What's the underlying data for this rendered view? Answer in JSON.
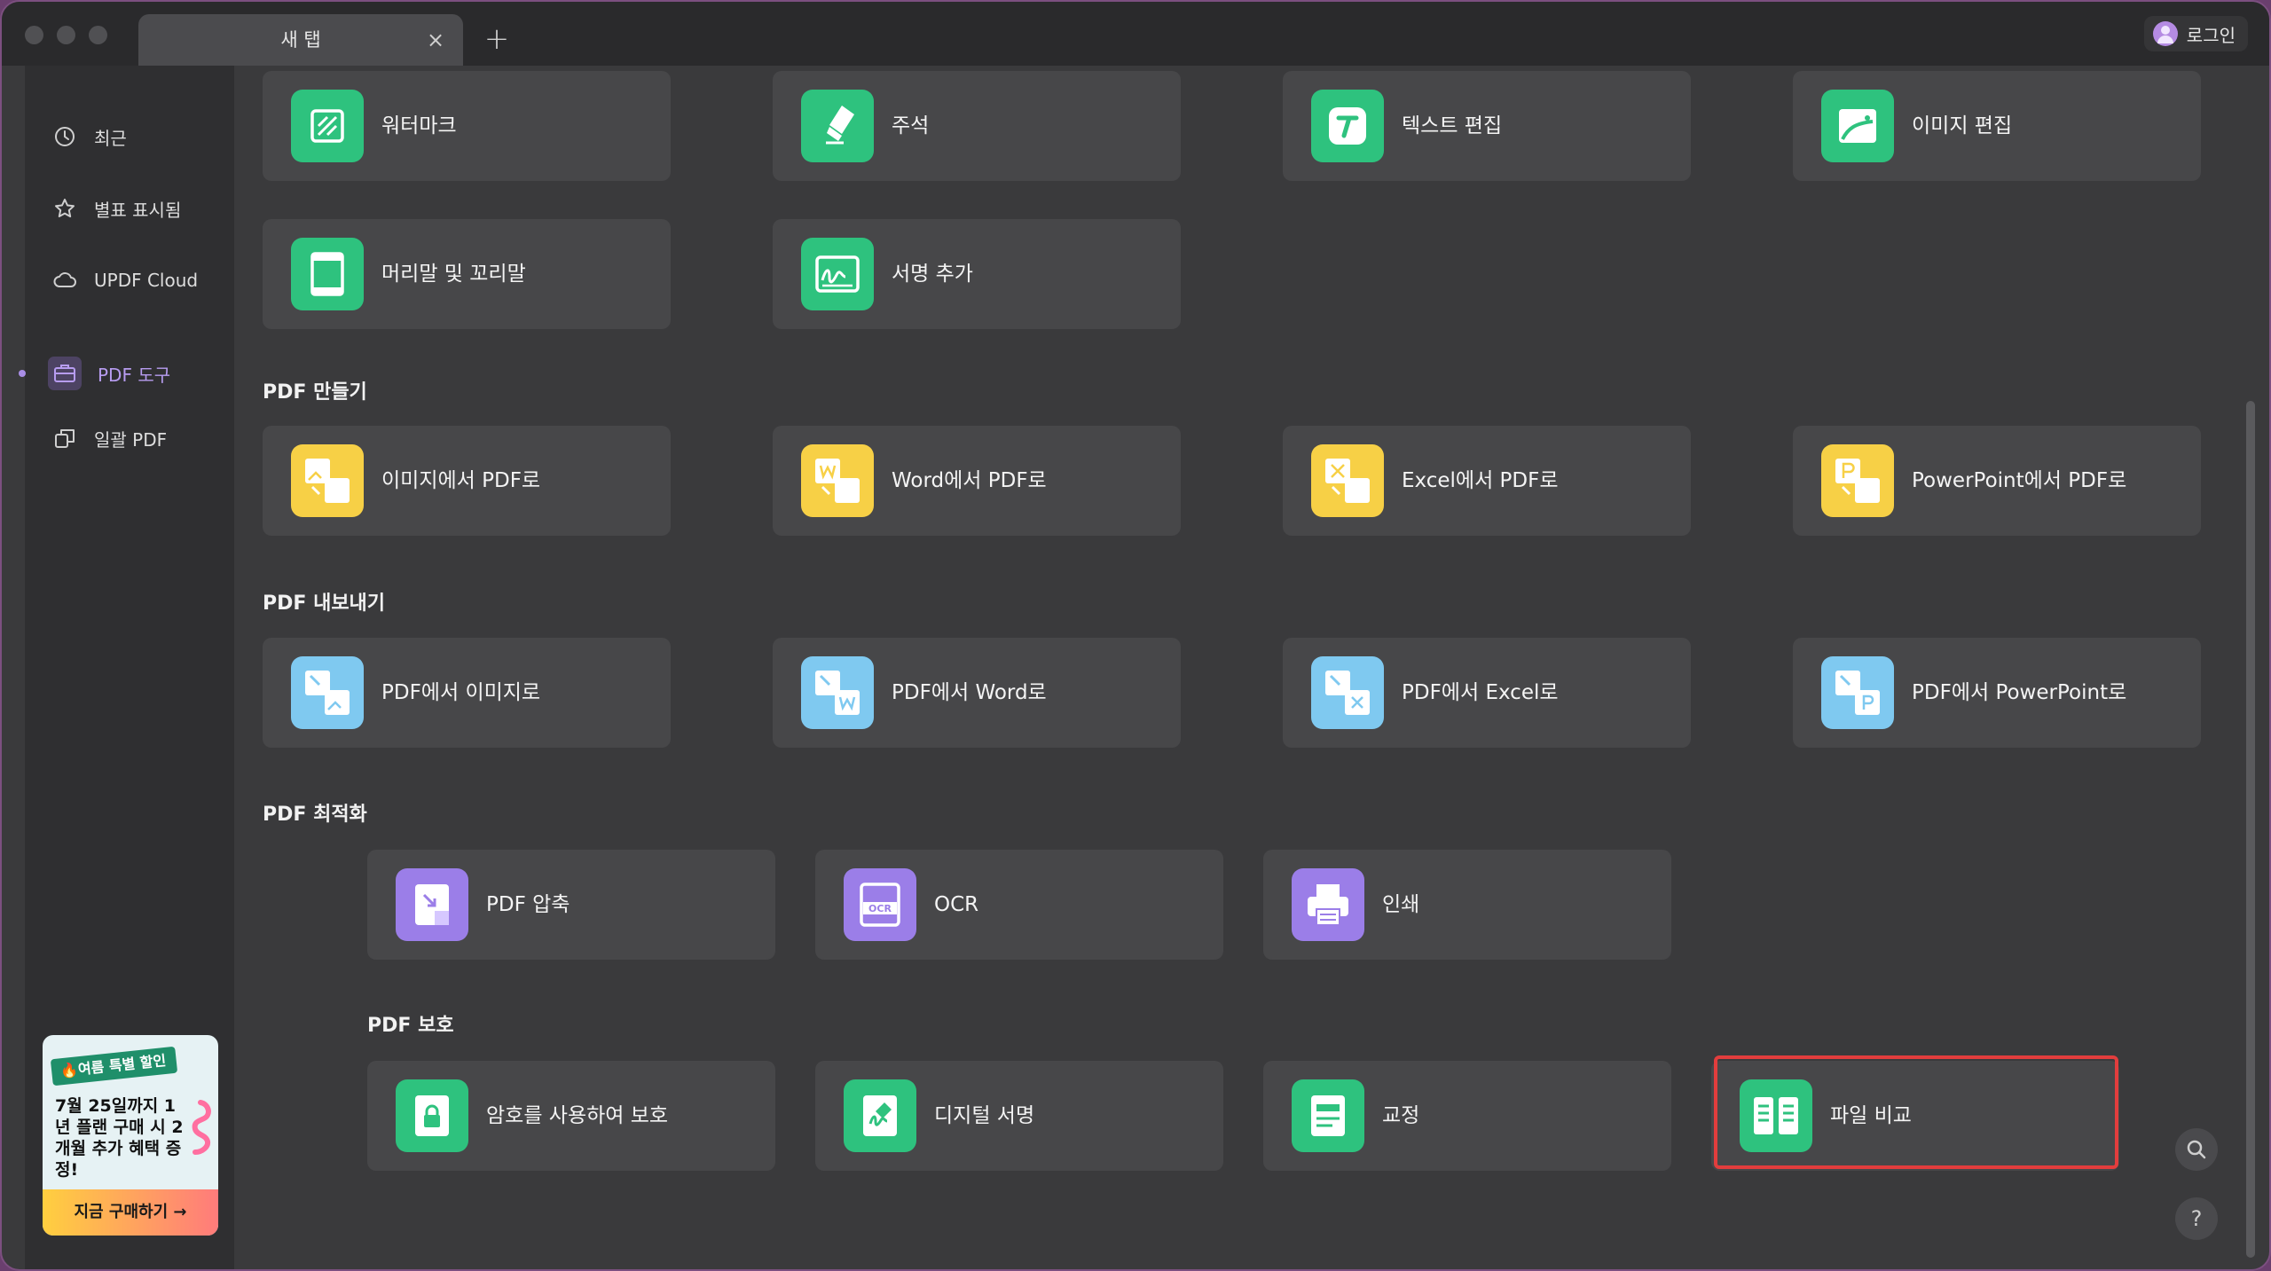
{
  "window": {
    "tab_title": "새 탭",
    "login_label": "로그인"
  },
  "sidebar": {
    "items": [
      {
        "label": "최근",
        "icon": "clock-icon"
      },
      {
        "label": "별표 표시됨",
        "icon": "star-icon"
      },
      {
        "label": "UPDF Cloud",
        "icon": "cloud-icon"
      },
      {
        "label": "PDF 도구",
        "icon": "briefcase-icon",
        "active": true
      },
      {
        "label": "일괄 PDF",
        "icon": "batch-icon"
      }
    ]
  },
  "promo": {
    "badge": "🔥여름 특별 할인",
    "text": "7월 25일까지 1년 플랜 구매 시 2개월 추가 혜택 증정!",
    "cta": "지금 구매하기 →"
  },
  "edit_tools": [
    {
      "label": "워터마크",
      "icon": "watermark-icon",
      "color": "#2ec27e"
    },
    {
      "label": "주석",
      "icon": "highlighter-icon",
      "color": "#2ec27e"
    },
    {
      "label": "텍스트 편집",
      "icon": "text-edit-icon",
      "color": "#2ec27e"
    },
    {
      "label": "이미지 편집",
      "icon": "image-edit-icon",
      "color": "#2ec27e"
    },
    {
      "label": "머리말 및 꼬리말",
      "icon": "header-footer-icon",
      "color": "#2ec27e"
    },
    {
      "label": "서명 추가",
      "icon": "signature-icon",
      "color": "#2ec27e"
    }
  ],
  "sections": {
    "create": {
      "title": "PDF 만들기",
      "items": [
        {
          "label": "이미지에서 PDF로",
          "icon": "image-to-pdf-icon",
          "color": "#f7d046"
        },
        {
          "label": "Word에서 PDF로",
          "icon": "word-to-pdf-icon",
          "color": "#f7d046"
        },
        {
          "label": "Excel에서 PDF로",
          "icon": "excel-to-pdf-icon",
          "color": "#f7d046"
        },
        {
          "label": "PowerPoint에서 PDF로",
          "icon": "powerpoint-to-pdf-icon",
          "color": "#f7d046"
        }
      ]
    },
    "export": {
      "title": "PDF 내보내기",
      "items": [
        {
          "label": "PDF에서 이미지로",
          "icon": "pdf-to-image-icon",
          "color": "#7fc9f0"
        },
        {
          "label": "PDF에서 Word로",
          "icon": "pdf-to-word-icon",
          "color": "#7fc9f0"
        },
        {
          "label": "PDF에서 Excel로",
          "icon": "pdf-to-excel-icon",
          "color": "#7fc9f0"
        },
        {
          "label": "PDF에서 PowerPoint로",
          "icon": "pdf-to-powerpoint-icon",
          "color": "#7fc9f0"
        }
      ]
    },
    "optimize": {
      "title": "PDF 최적화",
      "items": [
        {
          "label": "PDF 압축",
          "icon": "compress-icon",
          "color": "#9b7ee8"
        },
        {
          "label": "OCR",
          "icon": "ocr-icon",
          "color": "#9b7ee8"
        },
        {
          "label": "인쇄",
          "icon": "printer-icon",
          "color": "#9b7ee8"
        }
      ]
    },
    "protect": {
      "title": "PDF 보호",
      "items": [
        {
          "label": "암호를 사용하여 보호",
          "icon": "lock-icon",
          "color": "#2ec27e"
        },
        {
          "label": "디지털 서명",
          "icon": "digital-signature-icon",
          "color": "#2ec27e"
        },
        {
          "label": "교정",
          "icon": "redact-icon",
          "color": "#2ec27e"
        },
        {
          "label": "파일 비교",
          "icon": "compare-icon",
          "color": "#2ec27e",
          "highlighted": true
        }
      ]
    }
  }
}
